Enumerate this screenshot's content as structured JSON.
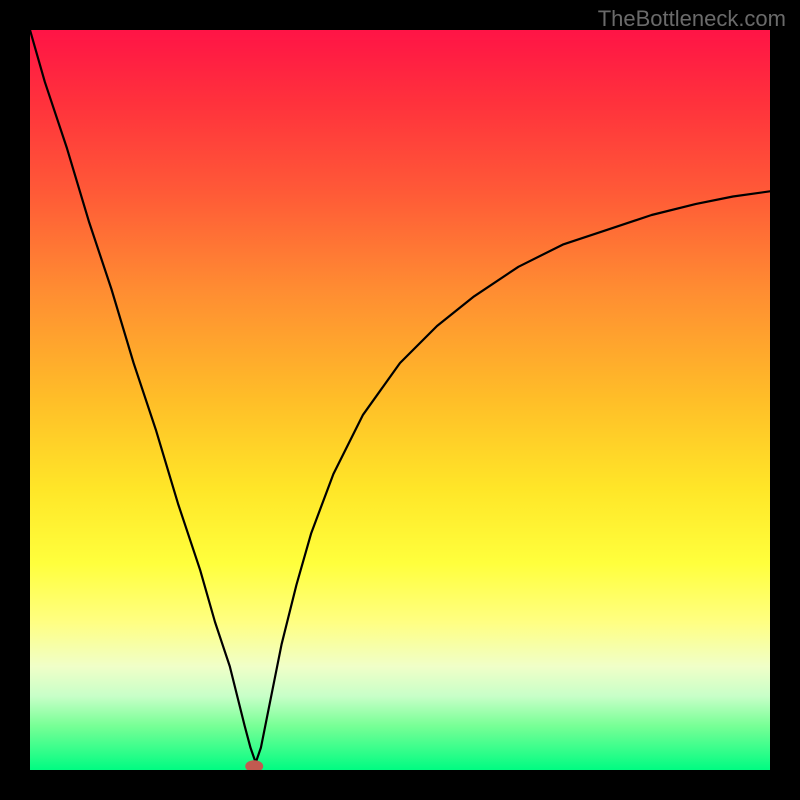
{
  "watermark": "TheBottleneck.com",
  "chart_data": {
    "type": "line",
    "title": "",
    "xlabel": "",
    "ylabel": "",
    "xlim": [
      0,
      100
    ],
    "ylim": [
      0,
      100
    ],
    "series": [
      {
        "name": "bottleneck-curve",
        "x": [
          0,
          2,
          5,
          8,
          11,
          14,
          17,
          20,
          23,
          25,
          27,
          28,
          29,
          29.8,
          30.5,
          31.2,
          32,
          33,
          34,
          36,
          38,
          41,
          45,
          50,
          55,
          60,
          66,
          72,
          78,
          84,
          90,
          95,
          100
        ],
        "y": [
          100,
          93,
          84,
          74,
          65,
          55,
          46,
          36,
          27,
          20,
          14,
          10,
          6,
          3,
          1,
          3,
          7,
          12,
          17,
          25,
          32,
          40,
          48,
          55,
          60,
          64,
          68,
          71,
          73,
          75,
          76.5,
          77.5,
          78.2
        ]
      }
    ],
    "marker": {
      "x": 30.3,
      "y": 0.5
    },
    "background_gradient": {
      "top": "#ff1446",
      "middle": "#ffe628",
      "bottom": "#00fc82"
    }
  }
}
